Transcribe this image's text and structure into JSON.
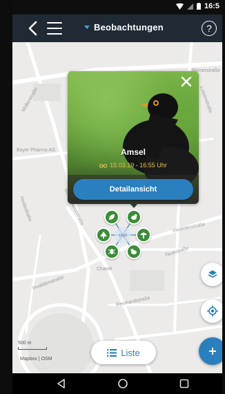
{
  "status_bar": {
    "time": "16:5"
  },
  "app_bar": {
    "title": "Beobachtungen",
    "help_label": "?"
  },
  "map": {
    "streets": [
      "Römerstraße",
      "Müllerstraße",
      "Bayer Pharma AG",
      "Heidestraße",
      "Scharnhorststraße",
      "Charité",
      "Invalidenstraße",
      "Tieckstraße",
      "Reinhardtstraße",
      "Luisenstraße",
      "Invalidenstraße"
    ],
    "scale": "500 m",
    "attribution": "Mapbox | OSM"
  },
  "popup": {
    "species": "Amsel",
    "date": "15.03.19 - 16:55 Uhr",
    "detail_button": "Detailansicht"
  },
  "cluster_center_label": "Hof",
  "list_button": "Liste",
  "colors": {
    "appbar": "#1f2a34",
    "accent": "#2a7fbf",
    "marker": "#3d8d3a",
    "date": "#e3c24a"
  }
}
